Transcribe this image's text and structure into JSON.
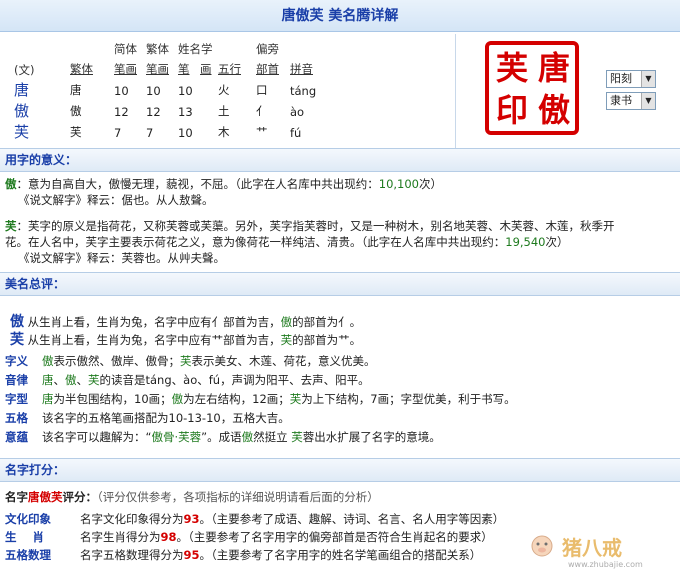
{
  "title": "唐傲芙  美名腾详解",
  "table": {
    "headers_top": [
      "简体",
      "繁体",
      "姓名学",
      "偏旁"
    ],
    "headers": [
      "(文)",
      "繁体",
      "笔画",
      "笔画",
      "笔",
      "画",
      "五行",
      "部首",
      "拼音"
    ],
    "rows": [
      {
        "char": "唐",
        "trad": "唐",
        "s1": "10",
        "s2": "10",
        "s3": "10",
        "wx": "火",
        "bs": "口",
        "py": "táng"
      },
      {
        "char": "傲",
        "trad": "傲",
        "s1": "12",
        "s2": "12",
        "s3": "13",
        "wx": "土",
        "bs": "亻",
        "py": "ào"
      },
      {
        "char": "芙",
        "trad": "芙",
        "s1": "7",
        "s2": "7",
        "s3": "10",
        "wx": "木",
        "bs": "艹",
        "py": "fú"
      }
    ]
  },
  "stamp": {
    "chars": [
      "芙",
      "唐",
      "印",
      "傲"
    ]
  },
  "selects": {
    "engrave": "阳刻",
    "font": "隶书"
  },
  "sections": {
    "meaning": "用字的意义：",
    "review": "美名总评：",
    "score": "名字打分："
  },
  "meaning": {
    "ao_char": "傲",
    "ao_text": "：意为自高自大，傲慢无理，藐视，不屈。（此字在人名库中共出现约：",
    "ao_count": "10,100",
    "ao_tail": "次）",
    "ao_shuowen": "《说文解字》释云：倨也。从人敖聲。",
    "fu_char": "芙",
    "fu_text1": "：芙字的原义是指荷花，又称芙蓉或芙蕖。另外，芙字指芙蓉时，又是一种树木，别名地芙蓉、木芙蓉、木莲，秋季开",
    "fu_text2": "花。在人名中，芙字主要表示荷花之义，意为像荷花一样纯洁、清贵。（此字在人名库中共出现约：",
    "fu_count": "19,540",
    "fu_tail": "次）",
    "fu_shuowen": "《说文解字》释云：芙蓉也。从艸夫聲。"
  },
  "review": {
    "ao_char": "傲",
    "ao_line": " 从生肖上看，生肖为兔，名字中应有亻部首为吉，",
    "ao_line_char": "傲",
    "ao_line_tail": "的部首为亻。",
    "fu_char": "芙",
    "fu_line": " 从生肖上看，生肖为兔，名字中应有艹部首为吉，",
    "fu_line_char": "芙",
    "fu_line_tail": "的部首为艹。",
    "items": [
      {
        "label": "字义",
        "text_parts": [
          "傲",
          "表示傲然、傲岸、傲骨；",
          "芙",
          "表示美女、木莲、荷花，意义优美。"
        ]
      },
      {
        "label": "音律",
        "text_parts": [
          "唐",
          "、",
          "傲",
          "、",
          "芙",
          "的读音是táng、ào、fú，声调为阳平、去声、阳平。"
        ]
      },
      {
        "label": "字型",
        "text_parts": [
          "唐",
          "为半包围结构，10画；",
          "傲",
          "为左右结构，12画；",
          "芙",
          "为上下结构，7画；字型优美，利于书写。"
        ]
      },
      {
        "label": "五格",
        "text": "该名字的五格笔画搭配为10-13-10，五格大吉。"
      },
      {
        "label": "意蕴",
        "text_parts": [
          "该名字可以趣解为：“",
          "傲骨·芙蓉",
          "”。成语",
          "傲",
          "然挺立 ",
          "芙",
          "蓉出水扩展了名字的意境。"
        ]
      }
    ]
  },
  "score": {
    "prefix": "名字",
    "name": "唐傲芙",
    "suffix": "评分：",
    "note": "（评分仅供参考，各项指标的详细说明请看后面的分析）",
    "rows": [
      {
        "label": "文化印象",
        "text": "名字文化印象得分为",
        "value": "93",
        "tail": "。（主要参考了成语、趣解、诗词、名言、名人用字等因素）"
      },
      {
        "label": "生    肖",
        "text": "名字生肖得分为",
        "value": "98",
        "tail": "。（主要参考了名字用字的偏旁部首是否符合生肖起名的要求）"
      },
      {
        "label": "五格数理",
        "text": "名字五格数理得分为",
        "value": "95",
        "tail": "。（主要参考了名字用字的姓名学笔画组合的搭配关系）"
      }
    ]
  },
  "watermark": {
    "text": "猪八戒",
    "url": "www.zhubajie.com"
  }
}
